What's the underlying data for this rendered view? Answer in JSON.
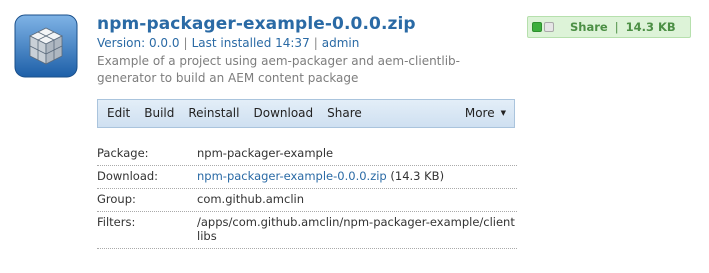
{
  "package": {
    "title": "npm-packager-example-0.0.0.zip",
    "version_text": "Version: 0.0.0",
    "installed_text": "Last installed 14:37",
    "user": "admin",
    "description": "Example of a project using aem-packager and aem-clientlib-generator to build an AEM content package"
  },
  "toolbar": {
    "buttons": [
      "Edit",
      "Build",
      "Reinstall",
      "Download",
      "Share"
    ],
    "more_label": "More"
  },
  "details": {
    "rows": [
      {
        "label": "Package:",
        "value": "npm-packager-example"
      },
      {
        "label": "Download:",
        "value": "npm-packager-example-0.0.0.zip",
        "suffix": " (14.3 KB)"
      },
      {
        "label": "Group:",
        "value": "com.github.amclin"
      },
      {
        "label": "Filters:",
        "value": "/apps/com.github.amclin/npm-packager-example/clientlibs"
      }
    ]
  },
  "share_badge": {
    "label": "Share",
    "separator": "|",
    "size": "14.3 KB"
  }
}
